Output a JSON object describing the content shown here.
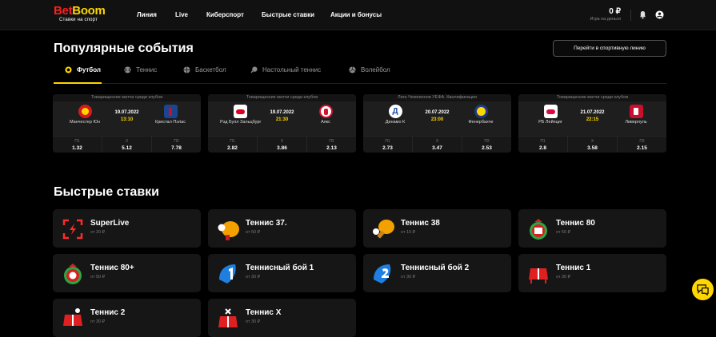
{
  "header": {
    "logo_bet": "Bet",
    "logo_boom": "Boom",
    "logo_sub": "Ставки на спорт",
    "nav": [
      "Линия",
      "Live",
      "Киберспорт",
      "Быстрые ставки",
      "Акции и бонусы"
    ],
    "balance_value": "0 ₽",
    "balance_sub": "Игра на деньги"
  },
  "popular": {
    "title": "Популярные события",
    "line_button": "Перейти в спортивную линию",
    "tabs": [
      "Футбол",
      "Теннис",
      "Баскетбол",
      "Настольный теннис",
      "Волейбол"
    ],
    "active_tab": "Футбол",
    "events": [
      {
        "league": "Товарищеские матчи среди клубов",
        "home": "Манчестер Юн",
        "away": "Кристал Пэлас",
        "date": "19.07.2022",
        "time": "13:10",
        "odds": [
          {
            "label": "П1",
            "value": "1.32"
          },
          {
            "label": "X",
            "value": "5.12"
          },
          {
            "label": "П2",
            "value": "7.78"
          }
        ]
      },
      {
        "league": "Товарищеские матчи среди клубов",
        "home": "Рэд Булл Зальцбург",
        "away": "Аякс",
        "date": "19.07.2022",
        "time": "21:30",
        "odds": [
          {
            "label": "П1",
            "value": "2.82"
          },
          {
            "label": "X",
            "value": "3.86"
          },
          {
            "label": "П2",
            "value": "2.13"
          }
        ]
      },
      {
        "league": "Лига Чемпионов УЕФА. Квалификация",
        "home": "Динамо К",
        "away": "Фенербахче",
        "date": "20.07.2022",
        "time": "23:00",
        "odds": [
          {
            "label": "П1",
            "value": "2.73"
          },
          {
            "label": "X",
            "value": "3.47"
          },
          {
            "label": "П2",
            "value": "2.53"
          }
        ]
      },
      {
        "league": "Товарищеские матчи среди клубов",
        "home": "РБ Лейпциг",
        "away": "Ливерпуль",
        "date": "21.07.2022",
        "time": "22:15",
        "odds": [
          {
            "label": "П1",
            "value": "2.8"
          },
          {
            "label": "X",
            "value": "3.58"
          },
          {
            "label": "П2",
            "value": "2.15"
          }
        ]
      }
    ]
  },
  "quick": {
    "title": "Быстрые ставки",
    "games": [
      {
        "name": "SuperLive",
        "sub": "от 20 ₽",
        "icon": "superlive-icon"
      },
      {
        "name": "Теннис 37.",
        "sub": "от 50 ₽",
        "icon": "paddle-icon"
      },
      {
        "name": "Теннис 38",
        "sub": "от 10 ₽",
        "icon": "paddle-38-icon"
      },
      {
        "name": "Теннис 80",
        "sub": "от 50 ₽",
        "icon": "tennis-80-icon"
      },
      {
        "name": "Теннис 80+",
        "sub": "от 50 ₽",
        "icon": "tennis-80plus-icon"
      },
      {
        "name": "Теннисный бой 1",
        "sub": "от 30 ₽",
        "icon": "battle-1-icon"
      },
      {
        "name": "Теннисный бой 2",
        "sub": "от 30 ₽",
        "icon": "battle-2-icon"
      },
      {
        "name": "Теннис 1",
        "sub": "от 30 ₽",
        "icon": "table-icon"
      },
      {
        "name": "Теннис 2",
        "sub": "от 30 ₽",
        "icon": "tennis-2-icon"
      },
      {
        "name": "Теннис X",
        "sub": "от 30 ₽",
        "icon": "tennis-x-icon"
      }
    ]
  },
  "colors": {
    "accent": "#ffd600",
    "brand_red": "#ff1e1e",
    "card": "#161616"
  }
}
